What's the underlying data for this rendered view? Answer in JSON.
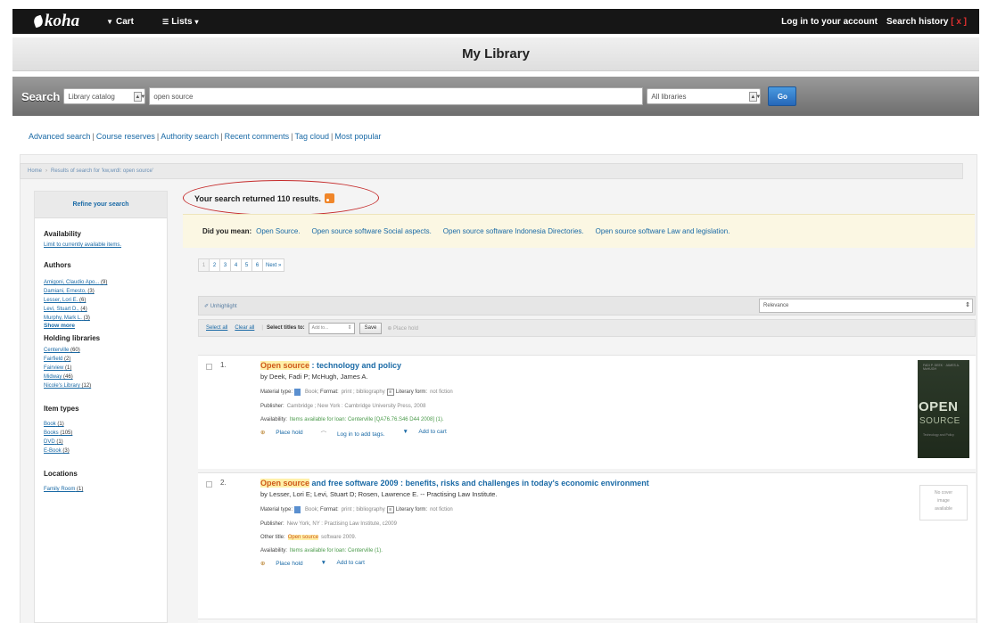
{
  "topbar": {
    "logo": "koha",
    "cart_label": "Cart",
    "lists_label": "Lists",
    "login_label": "Log in to your account",
    "history_label": "Search history",
    "history_clear": "[ x ]"
  },
  "library": {
    "name": "My Library"
  },
  "search": {
    "label": "Search",
    "catalog_selected": "Library catalog",
    "query": "open source",
    "libraries_selected": "All libraries",
    "go_label": "Go"
  },
  "moresearches": {
    "items": [
      "Advanced search",
      "Course reserves",
      "Authority search",
      "Recent comments",
      "Tag cloud",
      "Most popular"
    ],
    "sep": "|"
  },
  "breadcrumb": {
    "home": "Home",
    "current": "Results of search for 'kw,wrdl: open source'"
  },
  "sidebar": {
    "refine_title": "Refine your search",
    "availability_title": "Availability",
    "availability_link": "Limit to currently available items.",
    "authors_title": "Authors",
    "authors": [
      {
        "name": "Amigoni, Claudio Apo...",
        "count": "(9)"
      },
      {
        "name": "Damiani, Ernesto,",
        "count": "(3)"
      },
      {
        "name": "Lesser, Lori E.",
        "count": "(6)"
      },
      {
        "name": "Levi, Stuart D.,",
        "count": "(4)"
      },
      {
        "name": "Murphy, Mark L.",
        "count": "(3)"
      }
    ],
    "show_more": "Show more",
    "holding_title": "Holding libraries",
    "holdings": [
      {
        "name": "Centerville",
        "count": "(60)"
      },
      {
        "name": "Fairfield",
        "count": "(2)"
      },
      {
        "name": "Fairview",
        "count": "(1)"
      },
      {
        "name": "Midway",
        "count": "(46)"
      },
      {
        "name": "Nicole's Library",
        "count": "(12)"
      }
    ],
    "itemtypes_title": "Item types",
    "itemtypes": [
      {
        "name": "Book",
        "count": "(1)"
      },
      {
        "name": "Books",
        "count": "(105)"
      },
      {
        "name": "DVD",
        "count": "(1)"
      },
      {
        "name": "E-Book",
        "count": "(3)"
      }
    ],
    "locations_title": "Locations",
    "locations": [
      {
        "name": "Family Room",
        "count": "(1)"
      }
    ]
  },
  "results": {
    "count_text": "Your search returned 110 results.",
    "didyoumean_label": "Did you mean:",
    "suggestions": [
      "Open Source.",
      "Open source software Social aspects.",
      "Open source software Indonesia Directories.",
      "Open source software Law and legislation."
    ],
    "pages": [
      "1",
      "2",
      "3",
      "4",
      "5",
      "6",
      "Next »"
    ],
    "unhighlight_label": "Unhighlight",
    "sort_selected": "Relevance",
    "select_all": "Select all",
    "clear_all": "Clear all",
    "select_titles_label": "Select titles to:",
    "add_to_selected": "Add to...",
    "save_label": "Save",
    "place_hold_label": "Place hold"
  },
  "records": [
    {
      "num": "1.",
      "title_hl": "Open source",
      "title_rest": " : technology and policy",
      "author": "by Deek, Fadi P; McHugh, James A.",
      "material_label": "Material type:",
      "material_value": "Book;",
      "format_label": "Format:",
      "format_value": "print ; bibliography",
      "literary_label": "Literary form:",
      "literary_value": "not fiction",
      "publisher_label": "Publisher:",
      "publisher_value": "Cambridge ; New York : Cambridge University Press, 2008",
      "availability_label": "Availability:",
      "availability_value": "Items available for loan: Centerville [QA76.76.S46 D44 2008] (1).",
      "hold": "Place hold",
      "tags": "Log in to add tags.",
      "cart": "Add to cart",
      "cover_small": "FADI P. DEEK · JAMES A. McHUGH",
      "cover_big": "OPEN",
      "cover_big2": "SOURCE",
      "cover_sub": "Technology and Policy"
    },
    {
      "num": "2.",
      "title_hl": "Open source",
      "title_rest": " and free software 2009 : benefits, risks and challenges in today's economic environment",
      "author": "by Lesser, Lori E; Levi, Stuart D; Rosen, Lawrence E. -- Practising Law Institute.",
      "material_label": "Material type:",
      "material_value": "Book;",
      "format_label": "Format:",
      "format_value": "print ; bibliography",
      "literary_label": "Literary form:",
      "literary_value": "not fiction",
      "publisher_label": "Publisher:",
      "publisher_value": "New York, NY : Practising Law Institute, c2009",
      "other_label": "Other title:",
      "other_hl": "Open source",
      "other_rest": "software 2009.",
      "availability_label": "Availability:",
      "availability_value": "Items available for loan: Centerville (1).",
      "hold": "Place hold",
      "cart": "Add to cart",
      "nocover": [
        "No cover",
        "image",
        "available"
      ]
    }
  ]
}
